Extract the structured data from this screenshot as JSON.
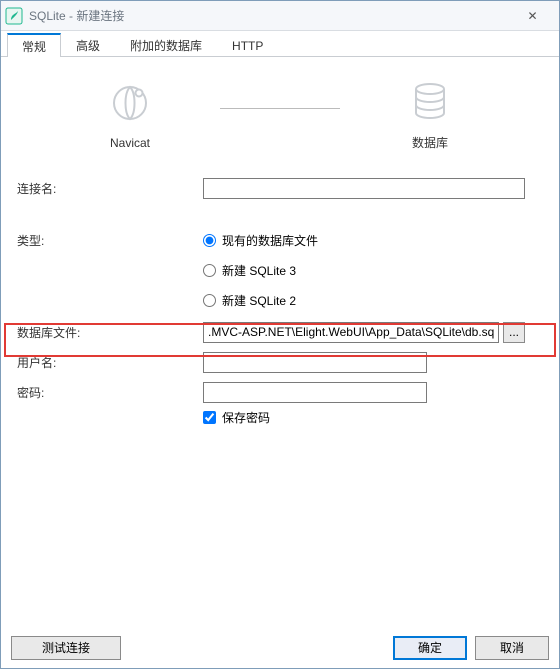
{
  "window": {
    "title": "SQLite - 新建连接",
    "close_glyph": "✕"
  },
  "tabs": [
    {
      "label": "常规",
      "active": true
    },
    {
      "label": "高级",
      "active": false
    },
    {
      "label": "附加的数据库",
      "active": false
    },
    {
      "label": "HTTP",
      "active": false
    }
  ],
  "diagram": {
    "left_label": "Navicat",
    "right_label": "数据库"
  },
  "form": {
    "connection_name": {
      "label": "连接名:",
      "value": ""
    },
    "type_label": "类型:",
    "type_options": [
      {
        "label": "现有的数据库文件",
        "selected": true
      },
      {
        "label": "新建 SQLite 3",
        "selected": false
      },
      {
        "label": "新建 SQLite 2",
        "selected": false
      }
    ],
    "db_file": {
      "label": "数据库文件:",
      "value": ".MVC-ASP.NET\\Elight.WebUI\\App_Data\\SQLite\\db.sqlite",
      "browse_glyph": "..."
    },
    "username": {
      "label": "用户名:",
      "value": ""
    },
    "password": {
      "label": "密码:",
      "value": ""
    },
    "save_password": {
      "label": "保存密码",
      "checked": true
    }
  },
  "footer": {
    "test_label": "测试连接",
    "ok_label": "确定",
    "cancel_label": "取消"
  }
}
